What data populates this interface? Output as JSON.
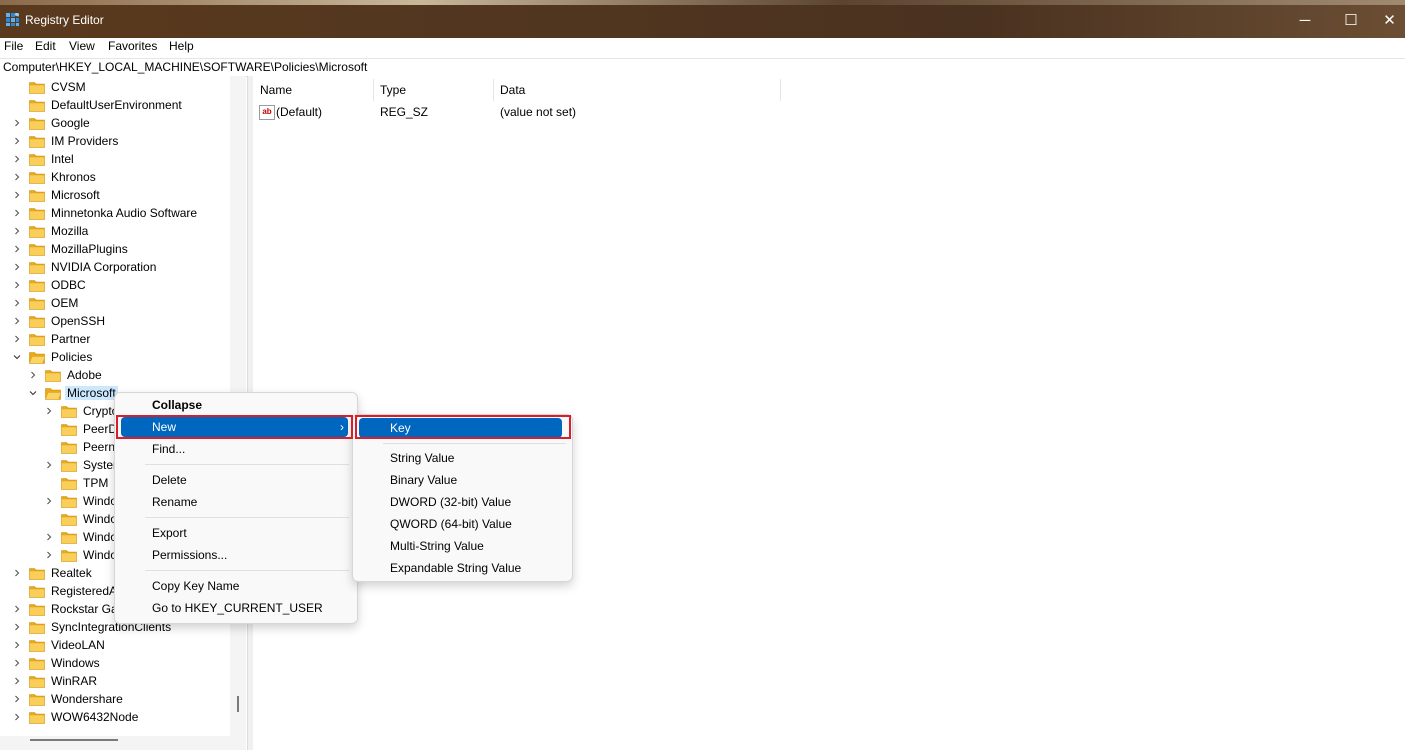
{
  "window": {
    "title": "Registry Editor",
    "minimize": "─",
    "maximize": "☐",
    "close": "✕"
  },
  "menu": [
    "File",
    "Edit",
    "View",
    "Favorites",
    "Help"
  ],
  "address": "Computer\\HKEY_LOCAL_MACHINE\\SOFTWARE\\Policies\\Microsoft",
  "tree": [
    {
      "label": "CVSM",
      "expander": "none"
    },
    {
      "label": "DefaultUserEnvironment",
      "expander": "none"
    },
    {
      "label": "Google",
      "expander": "collapsed"
    },
    {
      "label": "IM Providers",
      "expander": "collapsed"
    },
    {
      "label": "Intel",
      "expander": "collapsed"
    },
    {
      "label": "Khronos",
      "expander": "collapsed"
    },
    {
      "label": "Microsoft",
      "expander": "collapsed"
    },
    {
      "label": "Minnetonka Audio Software",
      "expander": "collapsed"
    },
    {
      "label": "Mozilla",
      "expander": "collapsed"
    },
    {
      "label": "MozillaPlugins",
      "expander": "collapsed"
    },
    {
      "label": "NVIDIA Corporation",
      "expander": "collapsed"
    },
    {
      "label": "ODBC",
      "expander": "collapsed"
    },
    {
      "label": "OEM",
      "expander": "collapsed"
    },
    {
      "label": "OpenSSH",
      "expander": "collapsed"
    },
    {
      "label": "Partner",
      "expander": "collapsed"
    },
    {
      "label": "Policies",
      "expander": "expanded"
    },
    {
      "label": "Adobe",
      "expander": "collapsed",
      "level": 1
    },
    {
      "label": "Microsoft",
      "expander": "expanded",
      "level": 1,
      "selected": true
    },
    {
      "label": "Crypto",
      "expander": "collapsed",
      "level": 2
    },
    {
      "label": "PeerDi",
      "expander": "none",
      "level": 2
    },
    {
      "label": "Peerne",
      "expander": "none",
      "level": 2
    },
    {
      "label": "System",
      "expander": "collapsed",
      "level": 2
    },
    {
      "label": "TPM",
      "expander": "none",
      "level": 2
    },
    {
      "label": "Windo",
      "expander": "collapsed",
      "level": 2
    },
    {
      "label": "Windo",
      "expander": "none",
      "level": 2
    },
    {
      "label": "Windo",
      "expander": "collapsed",
      "level": 2
    },
    {
      "label": "Windo",
      "expander": "collapsed",
      "level": 2
    },
    {
      "label": "Realtek",
      "expander": "collapsed"
    },
    {
      "label": "RegisteredAp",
      "expander": "none"
    },
    {
      "label": "Rockstar Gar",
      "expander": "collapsed"
    },
    {
      "label": "SyncIntegrationClients",
      "expander": "collapsed"
    },
    {
      "label": "VideoLAN",
      "expander": "collapsed"
    },
    {
      "label": "Windows",
      "expander": "collapsed"
    },
    {
      "label": "WinRAR",
      "expander": "collapsed"
    },
    {
      "label": "Wondershare",
      "expander": "collapsed"
    },
    {
      "label": "WOW6432Node",
      "expander": "collapsed"
    }
  ],
  "list": {
    "columns": [
      "Name",
      "Type",
      "Data"
    ],
    "rows": [
      {
        "icon": "ab",
        "name": "(Default)",
        "type": "REG_SZ",
        "data": "(value not set)"
      }
    ]
  },
  "context_menu": {
    "collapse": "Collapse",
    "new": "New",
    "find": "Find...",
    "delete": "Delete",
    "rename": "Rename",
    "export": "Export",
    "permissions": "Permissions...",
    "copy_key_name": "Copy Key Name",
    "goto_hkcu": "Go to HKEY_CURRENT_USER",
    "submenu_arrow": "›"
  },
  "submenu": {
    "key": "Key",
    "items": [
      "String Value",
      "Binary Value",
      "DWORD (32-bit) Value",
      "QWORD (64-bit) Value",
      "Multi-String Value",
      "Expandable String Value"
    ]
  },
  "colors": {
    "highlight": "#0067c0",
    "annotation": "#d81e2a",
    "folder": "#f5c242",
    "selection": "#cce8ff"
  }
}
